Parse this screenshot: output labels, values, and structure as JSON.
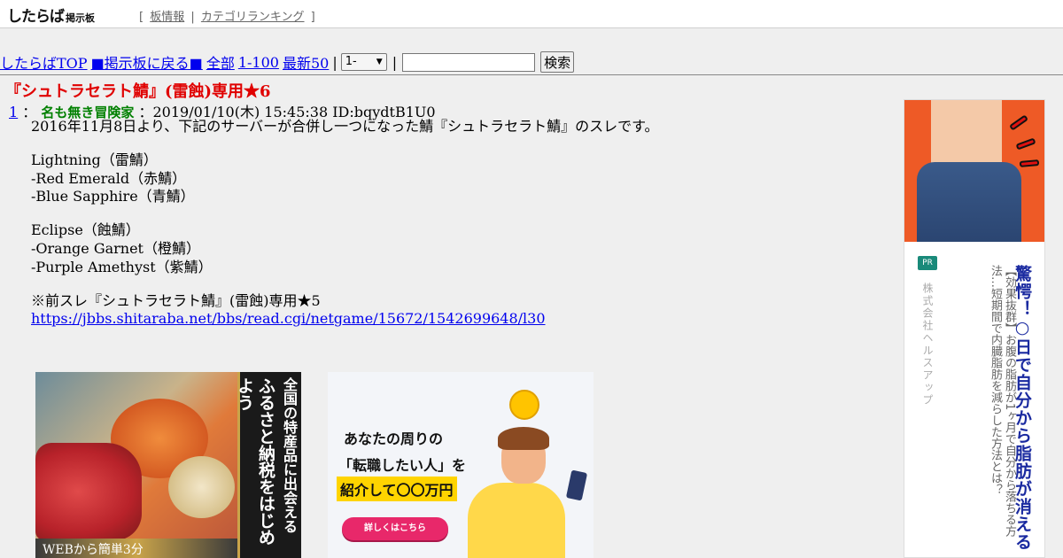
{
  "header": {
    "logo_main": "したらば",
    "logo_sub": "掲示板",
    "bracket_open": "[",
    "link_board_info": "板情報",
    "divider": "|",
    "link_category_ranking": "カテゴリランキング",
    "bracket_close": "]"
  },
  "nav": {
    "top_link": "したらばTOP",
    "back_link": "■掲示板に戻る■",
    "all_link": "全部",
    "range_link": "1-100",
    "latest_link": "最新50",
    "sep": "|",
    "select_value": "1-",
    "search_placeholder": "",
    "search_button": "検索"
  },
  "thread": {
    "title": "『シュトラセラト鯖』(雷蝕)専用★6"
  },
  "post": {
    "number": "1",
    "colon": "：",
    "name": "名も無き冒険家",
    "meta": "：2019/01/10(木) 15:45:38 ID:bqydtB1U0",
    "lines": [
      "2016年11月8日より、下記のサーバーが合併し一つになった鯖『シュトラセラト鯖』のスレです。",
      "Lightning（雷鯖）",
      "-Red Emerald（赤鯖）",
      "-Blue Sapphire（青鯖）",
      "Eclipse（蝕鯖）",
      "-Orange Garnet（橙鯖）",
      "-Purple Amethyst（紫鯖）",
      "※前スレ『シュトラセラト鯖』(雷蝕)専用★5"
    ],
    "link": "https://jbbs.shitaraba.net/bbs/read.cgi/netgame/15672/1542699648/l30"
  },
  "ad_furusato": {
    "side_text_1": "全国の特産品に出会える",
    "side_text_2": "ふるさと納税をはじめよう",
    "bottom_text": "WEBから簡単3分"
  },
  "ad_job": {
    "line1": "あなたの周りの",
    "line2": "「転職したい人」を",
    "line3": "紹介して〇〇万円",
    "button": "詳しくはこちら"
  },
  "ad_right": {
    "pr_badge": "PR",
    "company": "株式会社ヘルスアップ",
    "title": "驚愕！○日で自分から脂肪が消える",
    "description": "【効果抜群】お腹の脂肪が1ヶ月で自分から落ちる方法…短期間で内臓脂肪を減らした方法とは？"
  },
  "colors": {
    "link": "#0000ee",
    "thread_title": "#e00000",
    "poster_name": "#008000",
    "ad_title": "#1a2aa0"
  }
}
